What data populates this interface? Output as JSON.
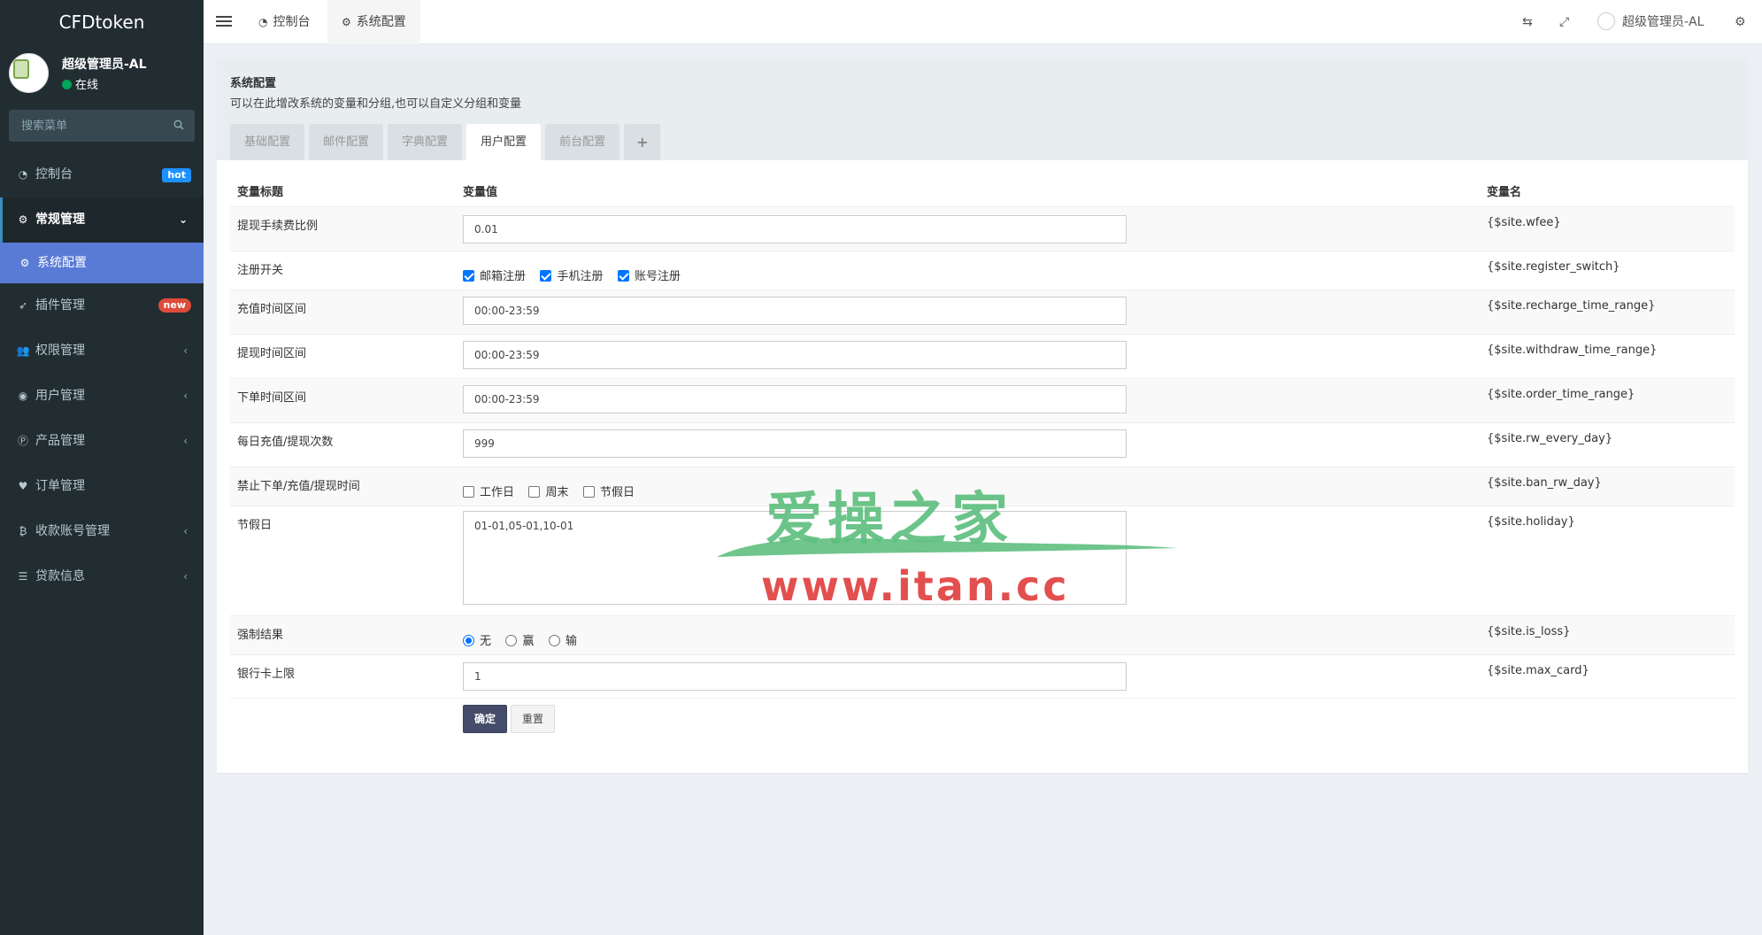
{
  "app": {
    "title": "CFDtoken"
  },
  "user": {
    "name": "超级管理员-AL",
    "status": "在线"
  },
  "search": {
    "placeholder": "搜索菜单"
  },
  "menu": {
    "items": [
      {
        "label": "控制台",
        "icon": "dashboard-icon",
        "badge": "hot"
      },
      {
        "label": "常规管理",
        "icon": "cogs-icon"
      },
      {
        "label": "系统配置",
        "icon": "gear-icon"
      },
      {
        "label": "插件管理",
        "icon": "rocket-icon",
        "badge": "new"
      },
      {
        "label": "权限管理",
        "icon": "users-icon"
      },
      {
        "label": "用户管理",
        "icon": "user-circle-icon"
      },
      {
        "label": "产品管理",
        "icon": "product-icon"
      },
      {
        "label": "订单管理",
        "icon": "heartbeat-icon"
      },
      {
        "label": "收款账号管理",
        "icon": "bitcoin-icon"
      },
      {
        "label": "贷款信息",
        "icon": "list-icon"
      }
    ]
  },
  "header": {
    "tabs": [
      {
        "label": "控制台"
      },
      {
        "label": "系统配置"
      }
    ],
    "user_name": "超级管理员-AL"
  },
  "panel": {
    "title": "系统配置",
    "description": "可以在此增改系统的变量和分组,也可以自定义分组和变量",
    "tabs": [
      "基础配置",
      "邮件配置",
      "字典配置",
      "用户配置",
      "前台配置",
      "+"
    ],
    "active_tab": "用户配置"
  },
  "table": {
    "headers": {
      "title": "变量标题",
      "value": "变量值",
      "name": "变量名"
    },
    "rows": [
      {
        "title": "提现手续费比例",
        "value": "0.01",
        "name": "{$site.wfee}"
      },
      {
        "title": "注册开关",
        "options": [
          "邮箱注册",
          "手机注册",
          "账号注册"
        ],
        "checked": [
          true,
          true,
          true
        ],
        "name": "{$site.register_switch}"
      },
      {
        "title": "充值时间区间",
        "value": "00:00-23:59",
        "name": "{$site.recharge_time_range}"
      },
      {
        "title": "提现时间区间",
        "value": "00:00-23:59",
        "name": "{$site.withdraw_time_range}"
      },
      {
        "title": "下单时间区间",
        "value": "00:00-23:59",
        "name": "{$site.order_time_range}"
      },
      {
        "title": "每日充值/提现次数",
        "value": "999",
        "name": "{$site.rw_every_day}"
      },
      {
        "title": "禁止下单/充值/提现时间",
        "options": [
          "工作日",
          "周末",
          "节假日"
        ],
        "checked": [
          false,
          false,
          false
        ],
        "name": "{$site.ban_rw_day}"
      },
      {
        "title": "节假日",
        "value": "01-01,05-01,10-01",
        "name": "{$site.holiday}"
      },
      {
        "title": "强制结果",
        "options": [
          "无",
          "赢",
          "输"
        ],
        "selected": "无",
        "name": "{$site.is_loss}"
      },
      {
        "title": "银行卡上限",
        "value": "1",
        "name": "{$site.max_card}"
      }
    ]
  },
  "buttons": {
    "submit": "确定",
    "reset": "重置"
  },
  "watermark": {
    "cn": "爱操之家",
    "url": "www.itan.cc"
  }
}
